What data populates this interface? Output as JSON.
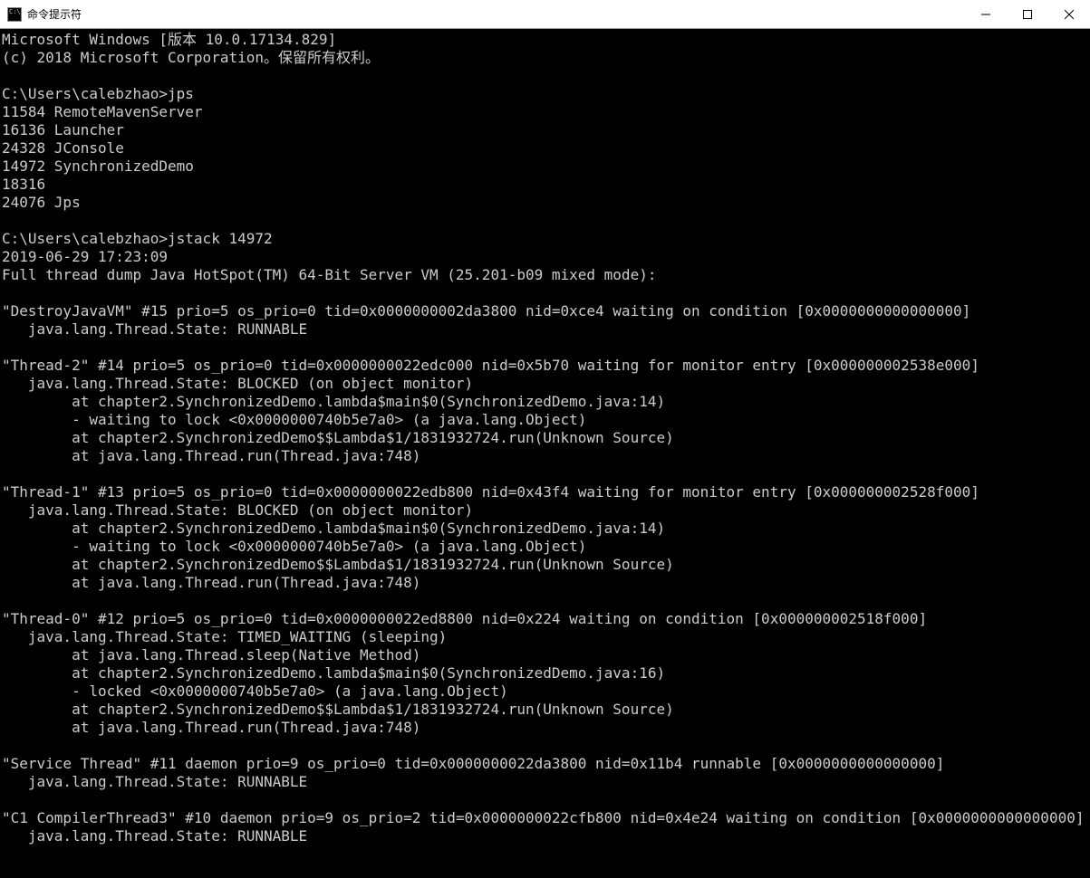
{
  "window": {
    "title": "命令提示符"
  },
  "lines": [
    "Microsoft Windows [版本 10.0.17134.829]",
    "(c) 2018 Microsoft Corporation。保留所有权利。",
    "",
    "C:\\Users\\calebzhao>jps",
    "11584 RemoteMavenServer",
    "16136 Launcher",
    "24328 JConsole",
    "14972 SynchronizedDemo",
    "18316",
    "24076 Jps",
    "",
    "C:\\Users\\calebzhao>jstack 14972",
    "2019-06-29 17:23:09",
    "Full thread dump Java HotSpot(TM) 64-Bit Server VM (25.201-b09 mixed mode):",
    "",
    "\"DestroyJavaVM\" #15 prio=5 os_prio=0 tid=0x0000000002da3800 nid=0xce4 waiting on condition [0x0000000000000000]",
    "   java.lang.Thread.State: RUNNABLE",
    "",
    "\"Thread-2\" #14 prio=5 os_prio=0 tid=0x0000000022edc000 nid=0x5b70 waiting for monitor entry [0x000000002538e000]",
    "   java.lang.Thread.State: BLOCKED (on object monitor)",
    "        at chapter2.SynchronizedDemo.lambda$main$0(SynchronizedDemo.java:14)",
    "        - waiting to lock <0x0000000740b5e7a0> (a java.lang.Object)",
    "        at chapter2.SynchronizedDemo$$Lambda$1/1831932724.run(Unknown Source)",
    "        at java.lang.Thread.run(Thread.java:748)",
    "",
    "\"Thread-1\" #13 prio=5 os_prio=0 tid=0x0000000022edb800 nid=0x43f4 waiting for monitor entry [0x000000002528f000]",
    "   java.lang.Thread.State: BLOCKED (on object monitor)",
    "        at chapter2.SynchronizedDemo.lambda$main$0(SynchronizedDemo.java:14)",
    "        - waiting to lock <0x0000000740b5e7a0> (a java.lang.Object)",
    "        at chapter2.SynchronizedDemo$$Lambda$1/1831932724.run(Unknown Source)",
    "        at java.lang.Thread.run(Thread.java:748)",
    "",
    "\"Thread-0\" #12 prio=5 os_prio=0 tid=0x0000000022ed8800 nid=0x224 waiting on condition [0x000000002518f000]",
    "   java.lang.Thread.State: TIMED_WAITING (sleeping)",
    "        at java.lang.Thread.sleep(Native Method)",
    "        at chapter2.SynchronizedDemo.lambda$main$0(SynchronizedDemo.java:16)",
    "        - locked <0x0000000740b5e7a0> (a java.lang.Object)",
    "        at chapter2.SynchronizedDemo$$Lambda$1/1831932724.run(Unknown Source)",
    "        at java.lang.Thread.run(Thread.java:748)",
    "",
    "\"Service Thread\" #11 daemon prio=9 os_prio=0 tid=0x0000000022da3800 nid=0x11b4 runnable [0x0000000000000000]",
    "   java.lang.Thread.State: RUNNABLE",
    "",
    "\"C1 CompilerThread3\" #10 daemon prio=9 os_prio=2 tid=0x0000000022cfb800 nid=0x4e24 waiting on condition [0x0000000000000000]",
    "   java.lang.Thread.State: RUNNABLE"
  ]
}
